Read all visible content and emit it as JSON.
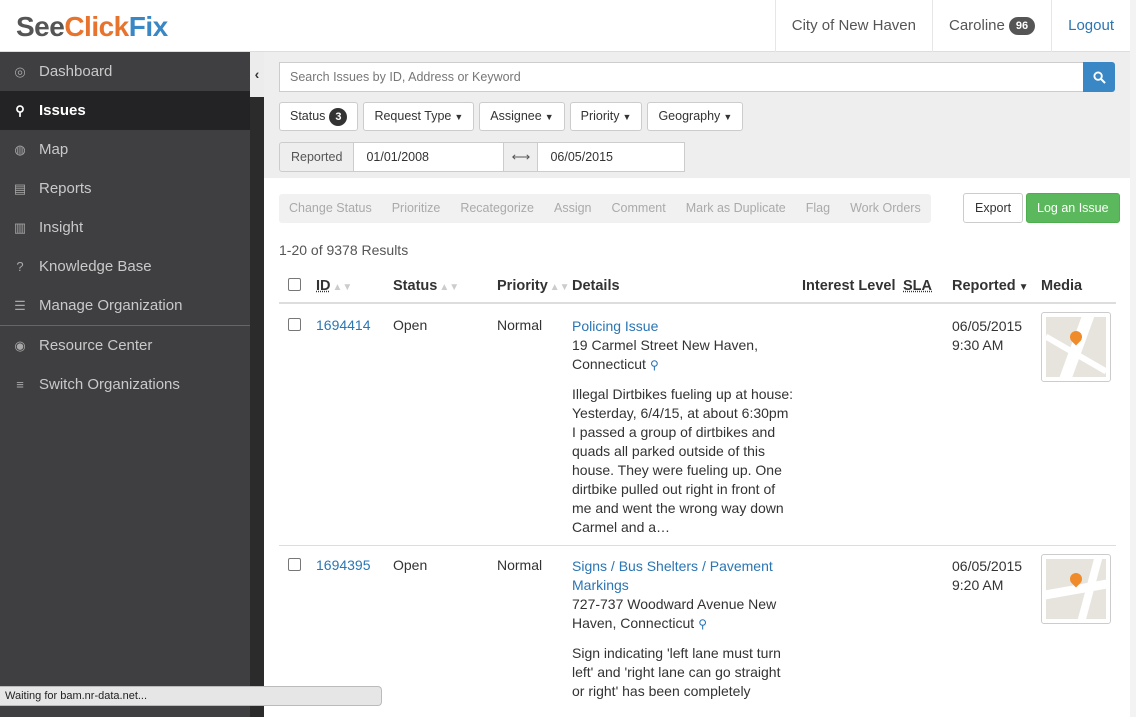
{
  "header": {
    "logo": {
      "see": "See",
      "click": "Click",
      "fix": "Fix"
    },
    "organization": "City of New Haven",
    "user": "Caroline",
    "user_count": "96",
    "logout": "Logout"
  },
  "sidebar": {
    "items": [
      {
        "label": "Dashboard",
        "icon": "dashboard-icon",
        "glyph": "◎"
      },
      {
        "label": "Issues",
        "icon": "map-pin-icon",
        "glyph": "⚲",
        "active": true
      },
      {
        "label": "Map",
        "icon": "globe-icon",
        "glyph": "◍"
      },
      {
        "label": "Reports",
        "icon": "document-icon",
        "glyph": "▤"
      },
      {
        "label": "Insight",
        "icon": "bar-chart-icon",
        "glyph": "▥"
      },
      {
        "label": "Knowledge Base",
        "icon": "question-icon",
        "glyph": "?"
      },
      {
        "label": "Manage Organization",
        "icon": "sliders-icon",
        "glyph": "☰"
      },
      {
        "label": "Resource Center",
        "icon": "lifebuoy-icon",
        "glyph": "◉"
      },
      {
        "label": "Switch Organizations",
        "icon": "list-icon",
        "glyph": "≡"
      }
    ],
    "collapse_glyph": "‹"
  },
  "search": {
    "placeholder": "Search Issues by ID, Address or Keyword"
  },
  "filters": {
    "status": "Status",
    "status_count": "3",
    "request_type": "Request Type",
    "assignee": "Assignee",
    "priority": "Priority",
    "geography": "Geography"
  },
  "dates": {
    "label": "Reported",
    "from": "01/01/2008",
    "to": "06/05/2015",
    "separator": "⟷"
  },
  "actions": [
    "Change Status",
    "Prioritize",
    "Recategorize",
    "Assign",
    "Comment",
    "Mark as Duplicate",
    "Flag",
    "Work Orders"
  ],
  "export_label": "Export",
  "log_issue_label": "Log an Issue",
  "results_text": "1-20 of 9378 Results",
  "table": {
    "headers": {
      "id": "ID",
      "status": "Status",
      "priority": "Priority",
      "details": "Details",
      "interest": "Interest Level",
      "sla": "SLA",
      "reported": "Reported",
      "media": "Media"
    },
    "rows": [
      {
        "id": "1694414",
        "status": "Open",
        "priority": "Normal",
        "title": "Policing Issue",
        "address": "19 Carmel Street New Haven, Connecticut",
        "description": "Illegal Dirtbikes fueling up at house: Yesterday, 6/4/15, at about 6:30pm I passed a group of dirtbikes and quads all parked outside of this house. They were fueling up. One dirtbike pulled out right in front of me and went the wrong way down Carmel and a…",
        "date": "06/05/2015",
        "time": "9:30 AM"
      },
      {
        "id": "1694395",
        "status": "Open",
        "priority": "Normal",
        "title": "Signs / Bus Shelters / Pavement Markings",
        "address": "727-737 Woodward Avenue New Haven, Connecticut",
        "description": "Sign indicating 'left lane must turn left' and 'right lane can go straight or right' has been completely",
        "date": "06/05/2015",
        "time": "9:20 AM"
      }
    ]
  },
  "statusbar": "Waiting for bam.nr-data.net..."
}
